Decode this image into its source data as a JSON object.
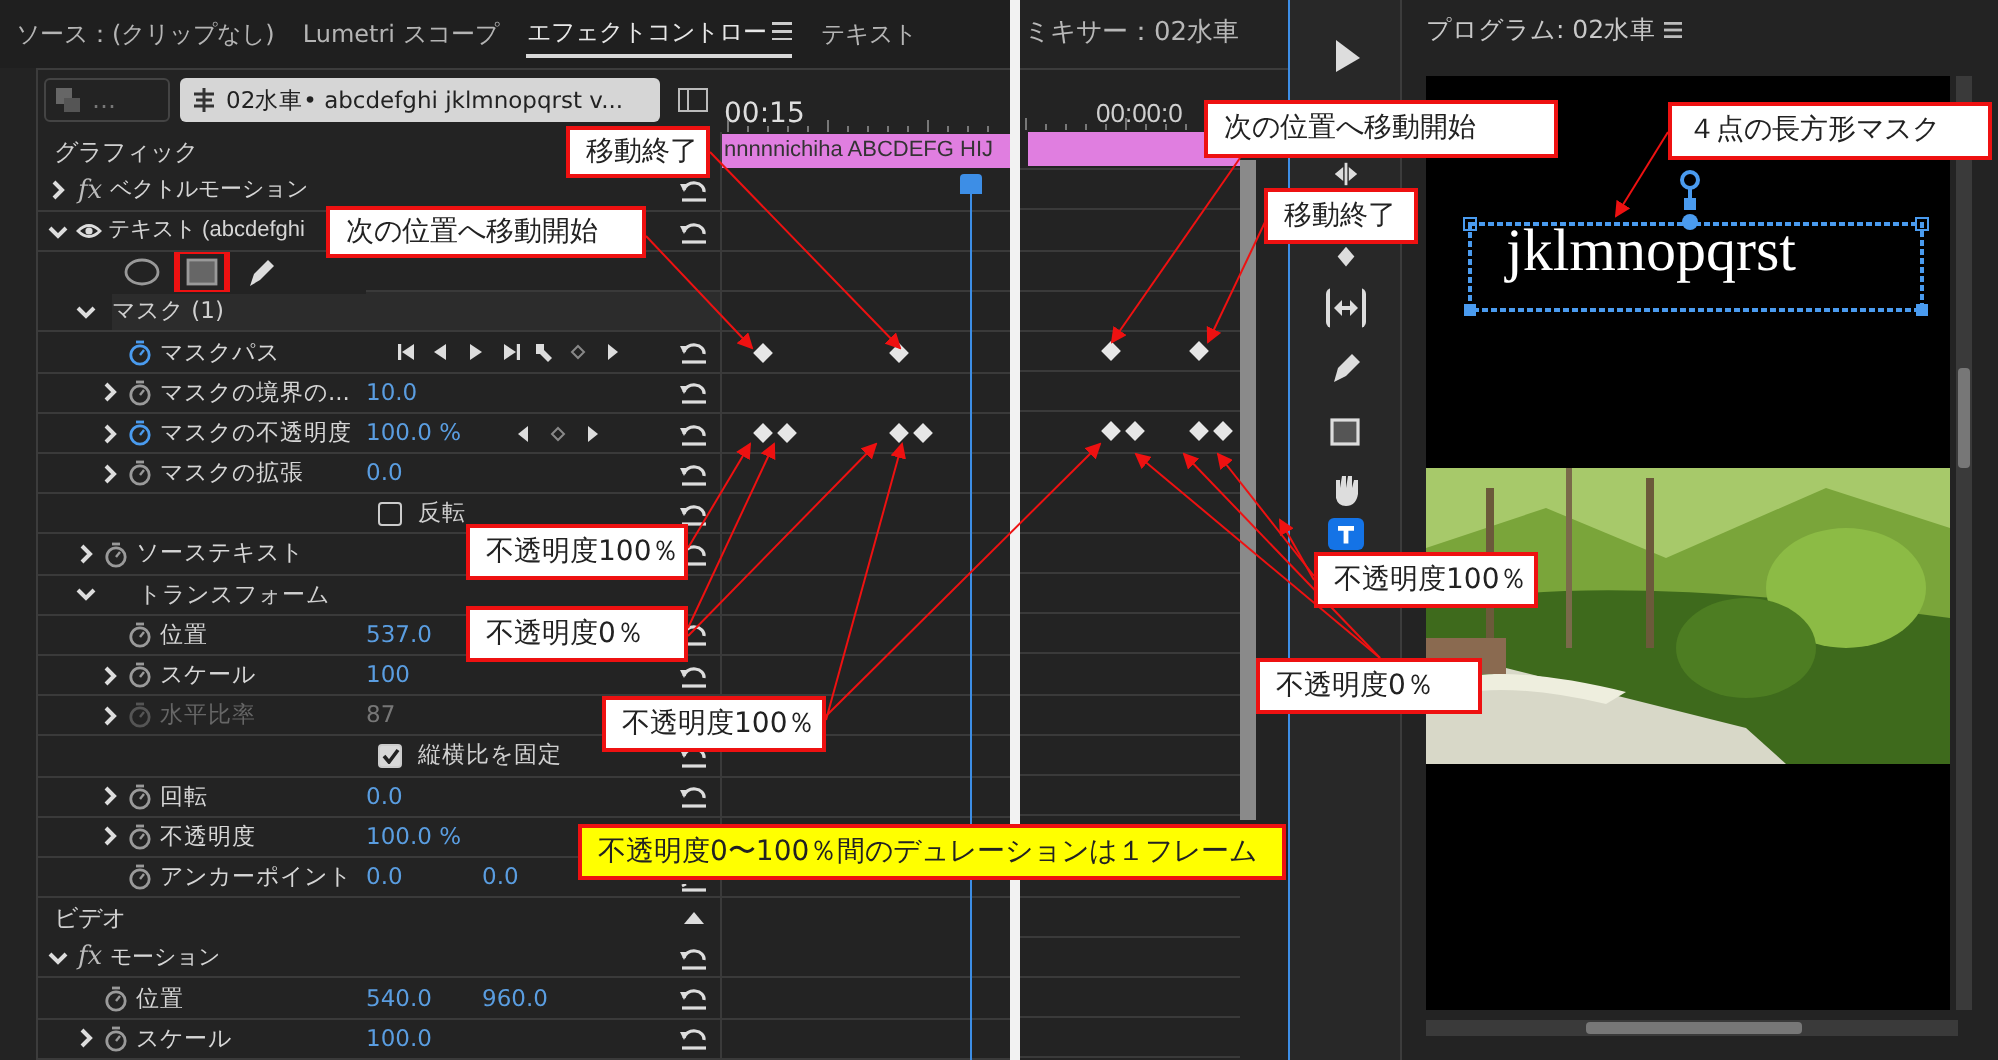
{
  "effect_controls": {
    "tabs": [
      {
        "label": "ソース：(クリップなし)",
        "selected": false
      },
      {
        "label": "Lumetri スコープ",
        "selected": false
      },
      {
        "label": "エフェクトコントロー",
        "selected": true
      },
      {
        "label": "テキスト",
        "selected": false
      }
    ],
    "master_clip": "…",
    "sequence_clip": "02水車• abcdefghi jklmnopqrst v...",
    "timecode": "00:15",
    "clip_bar": "nnnnnichiha ABCDEFG HIJ",
    "rows": [
      {
        "kind": "section",
        "label": "グラフィック",
        "children": [
          {
            "kind": "effect",
            "label": "ベクトルモーション",
            "badge": "fx",
            "expanded": false
          },
          {
            "kind": "effect",
            "label": "テキスト (abcdefghi",
            "visible": true,
            "expanded": true,
            "children": [
              {
                "kind": "mask_tools",
                "tools": [
                  {
                    "kind": "ellipse",
                    "selected": false
                  },
                  {
                    "kind": "rectangle",
                    "selected": true
                  },
                  {
                    "kind": "pen",
                    "selected": false
                  }
                ]
              },
              {
                "kind": "group",
                "label": "マスク (1)",
                "expanded": true,
                "children": [
                  {
                    "kind": "property",
                    "label": "マスクパス",
                    "animated": true,
                    "keyframe_controls": [
                      {
                        "kind": "step_back"
                      },
                      {
                        "kind": "previous_frame"
                      },
                      {
                        "kind": "play"
                      },
                      {
                        "kind": "step_forward"
                      },
                      {
                        "kind": "wrench"
                      },
                      {
                        "kind": "add"
                      },
                      {
                        "kind": "next"
                      }
                    ],
                    "keyframes": [
                      {
                        "kind": "single"
                      },
                      {
                        "kind": "single"
                      }
                    ]
                  },
                  {
                    "kind": "property",
                    "label": "マスクの境界の...",
                    "expandable": true,
                    "animated": false,
                    "value": "10.0"
                  },
                  {
                    "kind": "property",
                    "label": "マスクの不透明度",
                    "expandable": true,
                    "animated": true,
                    "value": "100.0 %",
                    "keyframe_controls": [
                      {
                        "kind": "previous"
                      },
                      {
                        "kind": "add"
                      },
                      {
                        "kind": "next"
                      }
                    ],
                    "keyframes": [
                      {
                        "kind": "pair"
                      },
                      {
                        "kind": "pair"
                      }
                    ]
                  },
                  {
                    "kind": "property",
                    "label": "マスクの拡張",
                    "expandable": true,
                    "animated": false,
                    "value": "0.0"
                  },
                  {
                    "kind": "checkbox",
                    "label": "反転",
                    "checked": false
                  }
                ]
              },
              {
                "kind": "property",
                "label": "ソーステキスト",
                "expandable": true,
                "animated": false
              },
              {
                "kind": "group",
                "label": "トランスフォーム",
                "expanded": true,
                "children": [
                  {
                    "kind": "property",
                    "label": "位置",
                    "animated": false,
                    "value": "537.0"
                  },
                  {
                    "kind": "property",
                    "label": "スケール",
                    "expandable": true,
                    "animated": false,
                    "value": "100"
                  },
                  {
                    "kind": "property",
                    "label": "水平比率",
                    "expandable": true,
                    "animated": false,
                    "disabled": true,
                    "value": "87"
                  },
                  {
                    "kind": "checkbox",
                    "label": "縦横比を固定",
                    "checked": true
                  },
                  {
                    "kind": "property",
                    "label": "回転",
                    "expandable": true,
                    "animated": false,
                    "value": "0.0"
                  },
                  {
                    "kind": "property",
                    "label": "不透明度",
                    "expandable": true,
                    "animated": false,
                    "value": "100.0 %"
                  },
                  {
                    "kind": "property",
                    "label": "アンカーポイント",
                    "animated": false,
                    "value": "0.0",
                    "value2": "0.0"
                  }
                ]
              }
            ]
          }
        ]
      },
      {
        "kind": "section",
        "label": "ビデオ",
        "children": [
          {
            "kind": "effect",
            "label": "モーション",
            "badge": "fx",
            "expanded": true,
            "children": [
              {
                "kind": "property",
                "label": "位置",
                "animated": false,
                "value": "540.0",
                "value2": "960.0"
              },
              {
                "kind": "property",
                "label": "スケール",
                "expandable": true,
                "animated": false,
                "value": "100.0"
              }
            ]
          }
        ]
      }
    ]
  },
  "mixer": {
    "title": "ミキサー：02水車",
    "timecode": "00:00:0"
  },
  "tools": [
    {
      "kind": "select",
      "selected": false
    },
    {
      "kind": "ripple",
      "selected": false
    },
    {
      "kind": "rolling",
      "selected": false
    },
    {
      "kind": "slip",
      "selected": false
    },
    {
      "kind": "pen",
      "selected": false
    },
    {
      "kind": "rectangle",
      "selected": false
    },
    {
      "kind": "hand",
      "selected": false
    },
    {
      "kind": "type",
      "selected": true
    }
  ],
  "program_monitor": {
    "title": "プログラム: 02水車",
    "overlay_text": "jklmnopqrst"
  },
  "callouts": [
    {
      "text": "移動終了",
      "kind": "note"
    },
    {
      "text": "次の位置へ移動開始",
      "kind": "note"
    },
    {
      "text": "不透明度100％",
      "kind": "note"
    },
    {
      "text": "不透明度0％",
      "kind": "note"
    },
    {
      "text": "不透明度100％",
      "kind": "note"
    },
    {
      "text": "不透明度0〜100％間のデュレーションは１フレーム",
      "kind": "highlight"
    },
    {
      "text": "次の位置へ移動開始",
      "kind": "note"
    },
    {
      "text": "移動終了",
      "kind": "note"
    },
    {
      "text": "４点の長方形マスク",
      "kind": "note"
    },
    {
      "text": "不透明度100％",
      "kind": "note"
    },
    {
      "text": "不透明度0％",
      "kind": "note"
    }
  ]
}
